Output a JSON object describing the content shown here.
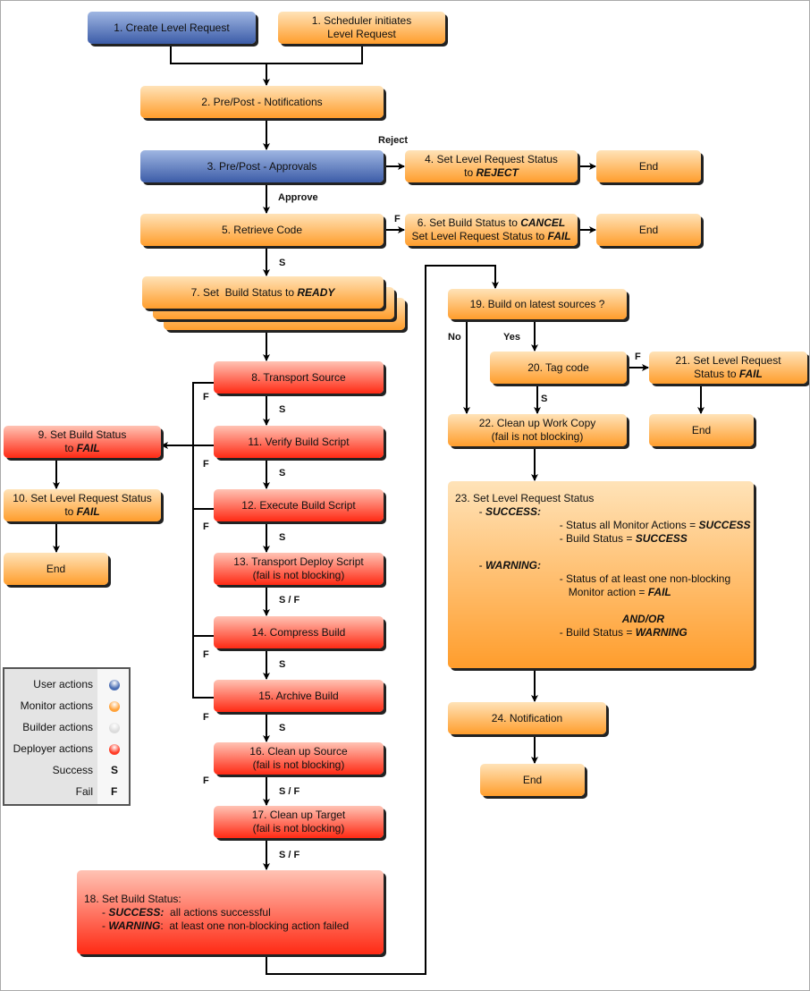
{
  "nodes": [
    {
      "id": "1a",
      "color": "blue",
      "lines": [
        [
          {
            "t": "1. Create Level Request"
          }
        ]
      ]
    },
    {
      "id": "1b",
      "color": "orange",
      "lines": [
        [
          {
            "t": "1. Scheduler initiates"
          }
        ],
        [
          {
            "t": "Level Request"
          }
        ]
      ]
    },
    {
      "id": "2",
      "color": "orange",
      "lines": [
        [
          {
            "t": "2. Pre/Post - Notifications"
          }
        ]
      ]
    },
    {
      "id": "3",
      "color": "blue",
      "lines": [
        [
          {
            "t": "3. Pre/Post - Approvals"
          }
        ]
      ]
    },
    {
      "id": "4",
      "color": "orange",
      "lines": [
        [
          {
            "t": "4. Set Level Request Status"
          }
        ],
        [
          {
            "t": "to "
          },
          {
            "t": "REJECT",
            "em": true
          }
        ]
      ]
    },
    {
      "id": "end4",
      "color": "orange",
      "lines": [
        [
          {
            "t": "End"
          }
        ]
      ]
    },
    {
      "id": "5",
      "color": "orange",
      "lines": [
        [
          {
            "t": "5. Retrieve Code"
          }
        ]
      ]
    },
    {
      "id": "6",
      "color": "orange",
      "lines": [
        [
          {
            "t": "6. Set Build Status to "
          },
          {
            "t": "CANCEL",
            "em": true
          }
        ],
        [
          {
            "t": "Set Level Request Status to "
          },
          {
            "t": "FAIL",
            "em": true
          }
        ]
      ]
    },
    {
      "id": "end6",
      "color": "orange",
      "lines": [
        [
          {
            "t": "End"
          }
        ]
      ]
    },
    {
      "id": "7",
      "color": "orange",
      "lines": [
        [
          {
            "t": "7. Set  Build Status to "
          },
          {
            "t": "READY",
            "em": true
          }
        ]
      ]
    },
    {
      "id": "8",
      "color": "red",
      "lines": [
        [
          {
            "t": "8. Transport Source"
          }
        ]
      ]
    },
    {
      "id": "9",
      "color": "red",
      "lines": [
        [
          {
            "t": "9. Set Build Status"
          }
        ],
        [
          {
            "t": "to "
          },
          {
            "t": "FAIL",
            "em": true
          }
        ]
      ]
    },
    {
      "id": "10",
      "color": "orange",
      "lines": [
        [
          {
            "t": "10. Set Level Request Status"
          }
        ],
        [
          {
            "t": "to "
          },
          {
            "t": "FAIL",
            "em": true
          }
        ]
      ]
    },
    {
      "id": "end10",
      "color": "orange",
      "lines": [
        [
          {
            "t": "End"
          }
        ]
      ]
    },
    {
      "id": "11",
      "color": "red",
      "lines": [
        [
          {
            "t": "11. Verify Build Script"
          }
        ]
      ]
    },
    {
      "id": "12",
      "color": "red",
      "lines": [
        [
          {
            "t": "12. Execute Build Script"
          }
        ]
      ]
    },
    {
      "id": "13",
      "color": "red",
      "lines": [
        [
          {
            "t": "13. Transport Deploy Script"
          }
        ],
        [
          {
            "t": "(fail is not blocking)"
          }
        ]
      ]
    },
    {
      "id": "14",
      "color": "red",
      "lines": [
        [
          {
            "t": "14. Compress Build"
          }
        ]
      ]
    },
    {
      "id": "15",
      "color": "red",
      "lines": [
        [
          {
            "t": "15. Archive Build"
          }
        ]
      ]
    },
    {
      "id": "16",
      "color": "red",
      "lines": [
        [
          {
            "t": "16. Clean up Source"
          }
        ],
        [
          {
            "t": "(fail is not blocking)"
          }
        ]
      ]
    },
    {
      "id": "17",
      "color": "red",
      "lines": [
        [
          {
            "t": "17. Clean up Target"
          }
        ],
        [
          {
            "t": "(fail is not blocking)"
          }
        ]
      ]
    },
    {
      "id": "18",
      "color": "red",
      "lines": [
        [
          {
            "t": "18. Set Build Status:"
          }
        ],
        [
          {
            "t": "      - "
          },
          {
            "t": "SUCCESS:",
            "em": true
          },
          {
            "t": "  all actions successful"
          }
        ],
        [
          {
            "t": "      - "
          },
          {
            "t": "WARNING",
            "em": true
          },
          {
            "t": ":  at least one non-blocking action failed"
          }
        ]
      ]
    },
    {
      "id": "19",
      "color": "orange",
      "lines": [
        [
          {
            "t": "19. Build on latest sources ?"
          }
        ]
      ]
    },
    {
      "id": "20",
      "color": "orange",
      "lines": [
        [
          {
            "t": "20. Tag code"
          }
        ]
      ]
    },
    {
      "id": "21",
      "color": "orange",
      "lines": [
        [
          {
            "t": "21. Set Level Request"
          }
        ],
        [
          {
            "t": "Status to "
          },
          {
            "t": "FAIL",
            "em": true
          }
        ]
      ]
    },
    {
      "id": "22",
      "color": "orange",
      "lines": [
        [
          {
            "t": "22. Clean up Work Copy"
          }
        ],
        [
          {
            "t": "(fail is not blocking)"
          }
        ]
      ]
    },
    {
      "id": "end21",
      "color": "orange",
      "lines": [
        [
          {
            "t": "End"
          }
        ]
      ]
    },
    {
      "id": "23",
      "color": "orange",
      "lines": [
        [
          {
            "t": "23. Set Level Request Status"
          }
        ],
        [
          {
            "t": "        - "
          },
          {
            "t": "SUCCESS:",
            "em": true
          }
        ],
        [
          {
            "t": "                                   - Status all Monitor Actions = "
          },
          {
            "t": "SUCCESS",
            "em": true
          }
        ],
        [
          {
            "t": "                                   - Build Status = "
          },
          {
            "t": "SUCCESS",
            "em": true
          }
        ],
        [
          {
            "t": " "
          }
        ],
        [
          {
            "t": "        - "
          },
          {
            "t": "WARNING:",
            "em": true
          }
        ],
        [
          {
            "t": "                                   - Status of at least one non-blocking"
          }
        ],
        [
          {
            "t": "                                      Monitor action = "
          },
          {
            "t": "FAIL",
            "em": true
          }
        ],
        [
          {
            "t": " "
          }
        ],
        [
          {
            "t": "                                                        "
          },
          {
            "t": "AND/OR",
            "em": true
          }
        ],
        [
          {
            "t": "                                   - Build Status = "
          },
          {
            "t": "WARNING",
            "em": true
          }
        ]
      ]
    },
    {
      "id": "24",
      "color": "orange",
      "lines": [
        [
          {
            "t": "24. Notification"
          }
        ]
      ]
    },
    {
      "id": "end24",
      "color": "orange",
      "lines": [
        [
          {
            "t": "End"
          }
        ]
      ]
    }
  ],
  "edge_labels": [
    "Reject",
    "Approve",
    "F",
    "S",
    "S",
    "F",
    "F",
    "F",
    "F",
    "F",
    "F",
    "S",
    "S",
    "S / F",
    "S",
    "S",
    "S / F",
    "S / F",
    "No",
    "Yes",
    "F",
    "S"
  ],
  "legend": [
    {
      "label": "User actions",
      "marker": "dot",
      "color": "#4a6db3"
    },
    {
      "label": "Monitor actions",
      "marker": "dot",
      "color": "#ffa23a"
    },
    {
      "label": "Builder actions",
      "marker": "dot",
      "color": "#dcdcdc"
    },
    {
      "label": "Deployer actions",
      "marker": "dot",
      "color": "#ff3c26"
    },
    {
      "label": "Success",
      "marker": "S"
    },
    {
      "label": "Fail",
      "marker": "F"
    }
  ]
}
